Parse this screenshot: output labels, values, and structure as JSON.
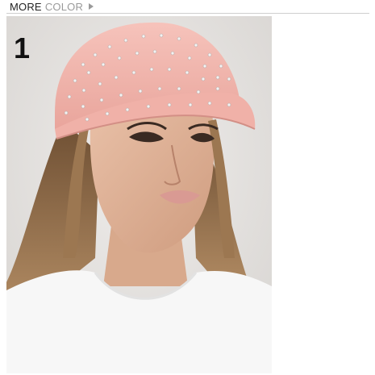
{
  "header": {
    "more_label": "MORE",
    "color_label": "COLOR",
    "arrow_icon": "caret-right-icon"
  },
  "product": {
    "variant_number": "1",
    "colors": {
      "cap": "#f2b2aa",
      "background": "#e6e4e2",
      "shirt": "#f7f7f7",
      "hair": "#8a6a48",
      "skin": "#e0b196"
    }
  }
}
